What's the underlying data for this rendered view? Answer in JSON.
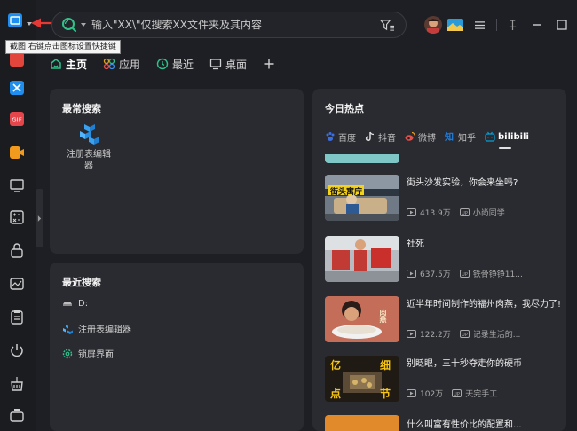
{
  "search": {
    "placeholder": "输入\"XX\\\"仅搜索XX文件夹及其内容"
  },
  "tooltip": {
    "text": "截图 右键点击图标设置快捷键"
  },
  "tabs": [
    {
      "label": "主页"
    },
    {
      "label": "应用"
    },
    {
      "label": "最近"
    },
    {
      "label": "桌面"
    }
  ],
  "frequent": {
    "title": "最常搜索",
    "item": {
      "line1": "注册表编辑",
      "line2": "器"
    }
  },
  "recent": {
    "title": "最近搜索",
    "items": [
      {
        "label": "D:"
      },
      {
        "label": "注册表编辑器"
      },
      {
        "label": "锁屏界面"
      }
    ]
  },
  "hot": {
    "title": "今日热点",
    "sources": [
      {
        "label": "百度"
      },
      {
        "label": "抖音"
      },
      {
        "label": "微博"
      },
      {
        "label": "知乎"
      },
      {
        "label": "bilibili"
      }
    ],
    "videos": [
      {
        "title": "街头沙发实验，你会来坐吗?",
        "views": "413.9万",
        "up": "小尚同学",
        "thumb_text": "街头寓庁"
      },
      {
        "title": "社死",
        "views": "637.5万",
        "up": "铁骨铮铮11...",
        "thumb_text": ""
      },
      {
        "title": "近半年时间制作的福州肉燕，我尽力了!",
        "views": "122.2万",
        "up": "记录生活的...",
        "thumb_text": "肉燕"
      },
      {
        "title": "别眨眼，三十秒夺走你的硬币",
        "views": "102万",
        "up": "天完手工",
        "thumb_text_a": "亿",
        "thumb_text_b": "细",
        "thumb_text_c": "点",
        "thumb_text_d": "节"
      }
    ],
    "partial_bottom_text": "什么叫富有性价比的配置和..."
  },
  "colors": {
    "accent": "#2fc28a",
    "bg": "#1e1f24",
    "panel": "#2a2b30",
    "bilibili": "#00a1d6"
  }
}
